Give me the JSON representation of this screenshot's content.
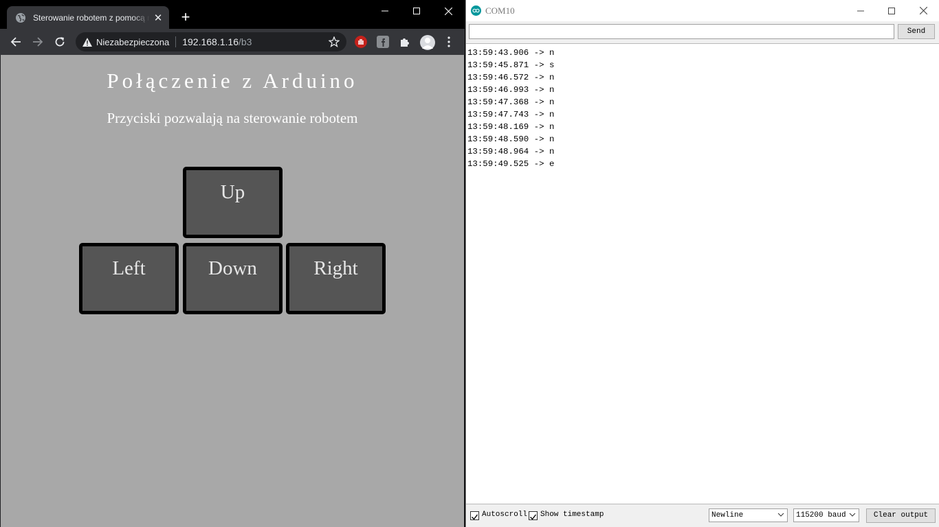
{
  "browser": {
    "tab_title": "Sterowanie robotem z pomocą mikrokontrolera",
    "security_label": "Niezabezpieczona",
    "url_host": "192.168.1.16",
    "url_path": "/b3",
    "newtab_glyph": "+",
    "tab_close_glyph": "✕"
  },
  "page": {
    "heading": "Połączenie z Arduino",
    "subheading": "Przyciski pozwalają na sterowanie robotem",
    "buttons": {
      "up": "Up",
      "left": "Left",
      "down": "Down",
      "right": "Right"
    }
  },
  "serial": {
    "title": "COM10",
    "send_label": "Send",
    "input_value": "",
    "log": [
      "13:59:43.906 -> n",
      "13:59:45.871 -> s",
      "13:59:46.572 -> n",
      "13:59:46.993 -> n",
      "13:59:47.368 -> n",
      "13:59:47.743 -> n",
      "13:59:48.169 -> n",
      "13:59:48.590 -> n",
      "13:59:48.964 -> n",
      "13:59:49.525 -> e"
    ],
    "autoscroll_label": "Autoscroll",
    "autoscroll_checked": true,
    "timestamp_label": "Show timestamp",
    "timestamp_checked": true,
    "line_ending": "Newline",
    "baud": "115200 baud",
    "clear_label": "Clear output"
  },
  "colors": {
    "page_background": "#a8a8a8",
    "button_fill": "#555555",
    "arduino_teal": "#00979c",
    "chrome_dark": "#35363a"
  }
}
